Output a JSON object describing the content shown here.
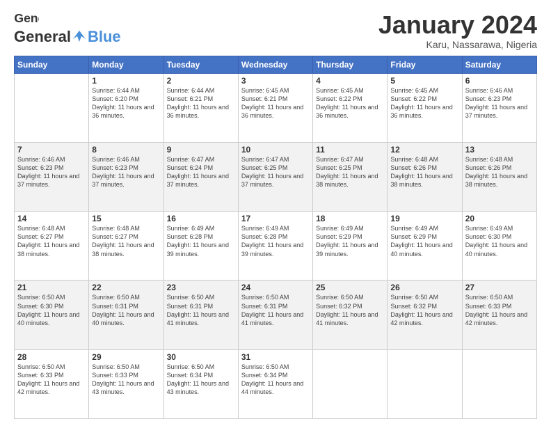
{
  "header": {
    "logo_general": "General",
    "logo_blue": "Blue",
    "month": "January 2024",
    "location": "Karu, Nassarawa, Nigeria"
  },
  "weekdays": [
    "Sunday",
    "Monday",
    "Tuesday",
    "Wednesday",
    "Thursday",
    "Friday",
    "Saturday"
  ],
  "weeks": [
    [
      {
        "day": "",
        "sunrise": "",
        "sunset": "",
        "daylight": ""
      },
      {
        "day": "1",
        "sunrise": "Sunrise: 6:44 AM",
        "sunset": "Sunset: 6:20 PM",
        "daylight": "Daylight: 11 hours and 36 minutes."
      },
      {
        "day": "2",
        "sunrise": "Sunrise: 6:44 AM",
        "sunset": "Sunset: 6:21 PM",
        "daylight": "Daylight: 11 hours and 36 minutes."
      },
      {
        "day": "3",
        "sunrise": "Sunrise: 6:45 AM",
        "sunset": "Sunset: 6:21 PM",
        "daylight": "Daylight: 11 hours and 36 minutes."
      },
      {
        "day": "4",
        "sunrise": "Sunrise: 6:45 AM",
        "sunset": "Sunset: 6:22 PM",
        "daylight": "Daylight: 11 hours and 36 minutes."
      },
      {
        "day": "5",
        "sunrise": "Sunrise: 6:45 AM",
        "sunset": "Sunset: 6:22 PM",
        "daylight": "Daylight: 11 hours and 36 minutes."
      },
      {
        "day": "6",
        "sunrise": "Sunrise: 6:46 AM",
        "sunset": "Sunset: 6:23 PM",
        "daylight": "Daylight: 11 hours and 37 minutes."
      }
    ],
    [
      {
        "day": "7",
        "sunrise": "Sunrise: 6:46 AM",
        "sunset": "Sunset: 6:23 PM",
        "daylight": "Daylight: 11 hours and 37 minutes."
      },
      {
        "day": "8",
        "sunrise": "Sunrise: 6:46 AM",
        "sunset": "Sunset: 6:23 PM",
        "daylight": "Daylight: 11 hours and 37 minutes."
      },
      {
        "day": "9",
        "sunrise": "Sunrise: 6:47 AM",
        "sunset": "Sunset: 6:24 PM",
        "daylight": "Daylight: 11 hours and 37 minutes."
      },
      {
        "day": "10",
        "sunrise": "Sunrise: 6:47 AM",
        "sunset": "Sunset: 6:25 PM",
        "daylight": "Daylight: 11 hours and 37 minutes."
      },
      {
        "day": "11",
        "sunrise": "Sunrise: 6:47 AM",
        "sunset": "Sunset: 6:25 PM",
        "daylight": "Daylight: 11 hours and 38 minutes."
      },
      {
        "day": "12",
        "sunrise": "Sunrise: 6:48 AM",
        "sunset": "Sunset: 6:26 PM",
        "daylight": "Daylight: 11 hours and 38 minutes."
      },
      {
        "day": "13",
        "sunrise": "Sunrise: 6:48 AM",
        "sunset": "Sunset: 6:26 PM",
        "daylight": "Daylight: 11 hours and 38 minutes."
      }
    ],
    [
      {
        "day": "14",
        "sunrise": "Sunrise: 6:48 AM",
        "sunset": "Sunset: 6:27 PM",
        "daylight": "Daylight: 11 hours and 38 minutes."
      },
      {
        "day": "15",
        "sunrise": "Sunrise: 6:48 AM",
        "sunset": "Sunset: 6:27 PM",
        "daylight": "Daylight: 11 hours and 38 minutes."
      },
      {
        "day": "16",
        "sunrise": "Sunrise: 6:49 AM",
        "sunset": "Sunset: 6:28 PM",
        "daylight": "Daylight: 11 hours and 39 minutes."
      },
      {
        "day": "17",
        "sunrise": "Sunrise: 6:49 AM",
        "sunset": "Sunset: 6:28 PM",
        "daylight": "Daylight: 11 hours and 39 minutes."
      },
      {
        "day": "18",
        "sunrise": "Sunrise: 6:49 AM",
        "sunset": "Sunset: 6:29 PM",
        "daylight": "Daylight: 11 hours and 39 minutes."
      },
      {
        "day": "19",
        "sunrise": "Sunrise: 6:49 AM",
        "sunset": "Sunset: 6:29 PM",
        "daylight": "Daylight: 11 hours and 40 minutes."
      },
      {
        "day": "20",
        "sunrise": "Sunrise: 6:49 AM",
        "sunset": "Sunset: 6:30 PM",
        "daylight": "Daylight: 11 hours and 40 minutes."
      }
    ],
    [
      {
        "day": "21",
        "sunrise": "Sunrise: 6:50 AM",
        "sunset": "Sunset: 6:30 PM",
        "daylight": "Daylight: 11 hours and 40 minutes."
      },
      {
        "day": "22",
        "sunrise": "Sunrise: 6:50 AM",
        "sunset": "Sunset: 6:31 PM",
        "daylight": "Daylight: 11 hours and 40 minutes."
      },
      {
        "day": "23",
        "sunrise": "Sunrise: 6:50 AM",
        "sunset": "Sunset: 6:31 PM",
        "daylight": "Daylight: 11 hours and 41 minutes."
      },
      {
        "day": "24",
        "sunrise": "Sunrise: 6:50 AM",
        "sunset": "Sunset: 6:31 PM",
        "daylight": "Daylight: 11 hours and 41 minutes."
      },
      {
        "day": "25",
        "sunrise": "Sunrise: 6:50 AM",
        "sunset": "Sunset: 6:32 PM",
        "daylight": "Daylight: 11 hours and 41 minutes."
      },
      {
        "day": "26",
        "sunrise": "Sunrise: 6:50 AM",
        "sunset": "Sunset: 6:32 PM",
        "daylight": "Daylight: 11 hours and 42 minutes."
      },
      {
        "day": "27",
        "sunrise": "Sunrise: 6:50 AM",
        "sunset": "Sunset: 6:33 PM",
        "daylight": "Daylight: 11 hours and 42 minutes."
      }
    ],
    [
      {
        "day": "28",
        "sunrise": "Sunrise: 6:50 AM",
        "sunset": "Sunset: 6:33 PM",
        "daylight": "Daylight: 11 hours and 42 minutes."
      },
      {
        "day": "29",
        "sunrise": "Sunrise: 6:50 AM",
        "sunset": "Sunset: 6:33 PM",
        "daylight": "Daylight: 11 hours and 43 minutes."
      },
      {
        "day": "30",
        "sunrise": "Sunrise: 6:50 AM",
        "sunset": "Sunset: 6:34 PM",
        "daylight": "Daylight: 11 hours and 43 minutes."
      },
      {
        "day": "31",
        "sunrise": "Sunrise: 6:50 AM",
        "sunset": "Sunset: 6:34 PM",
        "daylight": "Daylight: 11 hours and 44 minutes."
      },
      {
        "day": "",
        "sunrise": "",
        "sunset": "",
        "daylight": ""
      },
      {
        "day": "",
        "sunrise": "",
        "sunset": "",
        "daylight": ""
      },
      {
        "day": "",
        "sunrise": "",
        "sunset": "",
        "daylight": ""
      }
    ]
  ]
}
